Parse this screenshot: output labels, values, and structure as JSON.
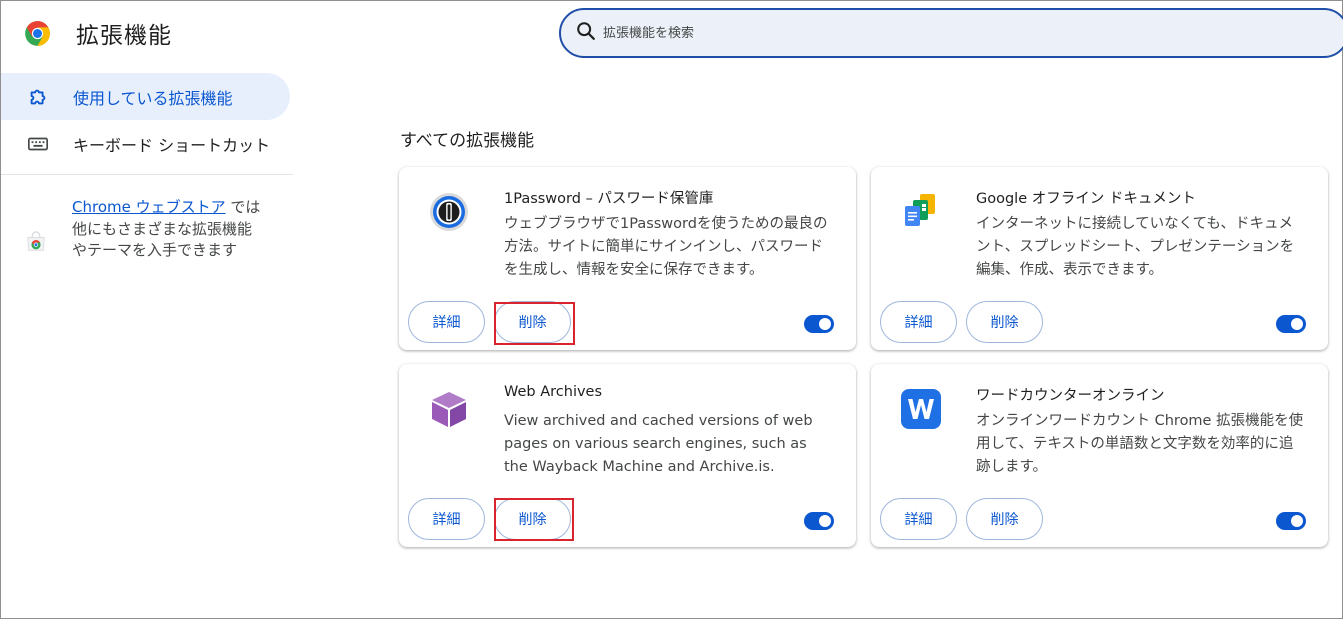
{
  "header": {
    "title": "拡張機能",
    "search_placeholder": "拡張機能を検索",
    "search_value": ""
  },
  "sidebar": {
    "items": [
      {
        "label": "使用している拡張機能",
        "icon": "puzzle-icon",
        "active": true
      },
      {
        "label": "キーボード ショートカット",
        "icon": "keyboard-icon",
        "active": false
      }
    ],
    "store_link": "Chrome ウェブストア",
    "store_text": " では他にもさまざまな拡張機能やテーマを入手できます"
  },
  "main": {
    "section_title": "すべての拡張機能",
    "cards": [
      {
        "name": "1Password – パスワード保管庫",
        "description": "ウェブブラウザで1Passwordを使うための最良の方法。サイトに簡単にサインインし、パスワードを生成し、情報を安全に保存できます。",
        "icon": "onepassword-icon",
        "details_label": "詳細",
        "remove_label": "削除",
        "enabled": true
      },
      {
        "name": "Google オフライン ドキュメント",
        "description": "インターネットに接続していなくても、ドキュメント、スプレッドシート、プレゼンテーションを編集、作成、表示できます。",
        "icon": "google-docs-offline-icon",
        "details_label": "詳細",
        "remove_label": "削除",
        "enabled": true
      },
      {
        "name": "Web Archives",
        "description": "View archived and cached versions of web pages on various search engines, such as the Wayback Machine and Archive.is.",
        "icon": "web-archives-cube-icon",
        "details_label": "詳細",
        "remove_label": "削除",
        "enabled": true
      },
      {
        "name": "ワードカウンターオンライン",
        "description": "オンラインワードカウント Chrome 拡張機能を使用して、テキストの単語数と文字数を効率的に追跡します。",
        "icon": "word-counter-w-icon",
        "details_label": "詳細",
        "remove_label": "削除",
        "enabled": true
      }
    ]
  },
  "colors": {
    "accent": "#0b57d0",
    "highlight": "#d9232d",
    "active_nav_bg": "#e8effc"
  }
}
